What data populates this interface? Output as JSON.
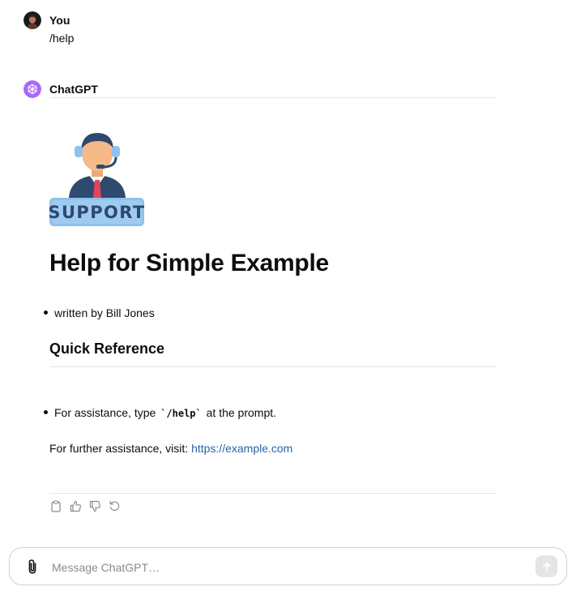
{
  "conversation": {
    "user": {
      "name": "You",
      "message": "/help"
    },
    "assistant": {
      "name": "ChatGPT",
      "badge_text": "SUPPORT",
      "title": "Help for Simple Example",
      "author_line": "written by Bill Jones",
      "section_title": "Quick Reference",
      "assist_prefix": "For assistance, type",
      "assist_code": "`/help`",
      "assist_suffix": "at the prompt.",
      "further_prefix": "For further assistance, visit:",
      "further_link": "https://example.com"
    }
  },
  "actions": [
    "copy-icon",
    "thumbs-up-icon",
    "thumbs-down-icon",
    "regenerate-icon"
  ],
  "composer": {
    "placeholder": "Message ChatGPT…"
  },
  "colors": {
    "accent_purple": "#ab68ff",
    "link": "#2964aa",
    "badge_bg": "#8fc2ee",
    "badge_text": "#2c4a6e"
  }
}
